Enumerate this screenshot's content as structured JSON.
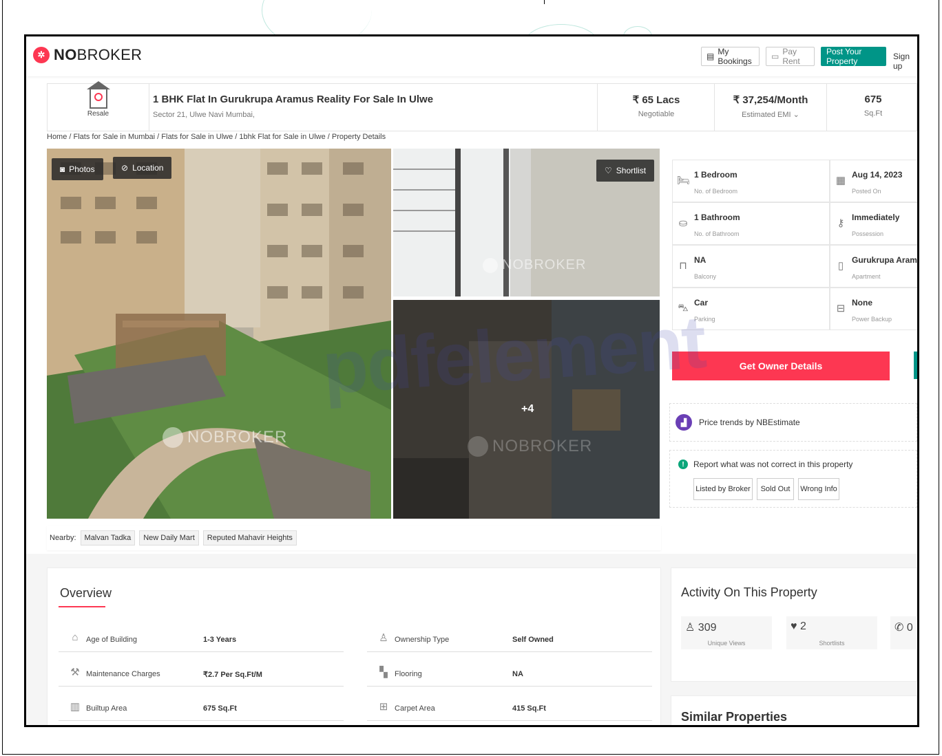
{
  "header": {
    "logo_bold": "NO",
    "logo_rest": "BROKER",
    "my_bookings": "My Bookings",
    "pay_rent": "Pay Rent",
    "post_property": "Post Your Property",
    "sign_up": "Sign up"
  },
  "listing": {
    "badge": "Resale",
    "title": "1 BHK Flat In Gurukrupa Aramus Reality For Sale In Ulwe",
    "address": "Sector 21, Ulwe Navi Mumbai,",
    "price": "₹ 65 Lacs",
    "price_note": "Negotiable",
    "emi": "₹ 37,254/Month",
    "emi_note": "Estimated EMI ⌄",
    "area": "675",
    "area_unit": "Sq.Ft"
  },
  "breadcrumb": "Home / Flats for Sale in Mumbai / Flats for Sale in Ulwe / 1bhk Flat for Sale in Ulwe / Property Details",
  "gallery": {
    "photos_label": "Photos",
    "location_label": "Location",
    "shortlist_label": "Shortlist",
    "watermark": "NOBROKER",
    "more_count": "+4"
  },
  "nearby": {
    "label": "Nearby:",
    "tags": [
      "Malvan Tadka",
      "New Daily Mart",
      "Reputed Mahavir Heights"
    ]
  },
  "specs": [
    {
      "value": "1 Bedroom",
      "label": "No. of Bedroom",
      "icon": "bed-icon"
    },
    {
      "value": "Aug 14, 2023",
      "label": "Posted On",
      "icon": "calendar-icon"
    },
    {
      "value": "1 Bathroom",
      "label": "No. of Bathroom",
      "icon": "bath-icon"
    },
    {
      "value": "Immediately",
      "label": "Possession",
      "icon": "key-icon"
    },
    {
      "value": "NA",
      "label": "Balcony",
      "icon": "balcony-icon"
    },
    {
      "value": "Gurukrupa Aramus ...",
      "label": "Apartment",
      "icon": "building-icon"
    },
    {
      "value": "Car",
      "label": "Parking",
      "icon": "car-icon"
    },
    {
      "value": "None",
      "label": "Power Backup",
      "icon": "battery-icon"
    }
  ],
  "actions": {
    "owner_details": "Get Owner Details",
    "price_trends": "Price trends by NBEstimate",
    "report_question": "Report what was not correct in this property",
    "report_options": [
      "Listed by Broker",
      "Sold Out",
      "Wrong Info"
    ]
  },
  "overview": {
    "title": "Overview",
    "rows": [
      {
        "key": "Age of Building",
        "value": "1-3 Years",
        "icon": "building-age-icon"
      },
      {
        "key": "Ownership Type",
        "value": "Self Owned",
        "icon": "ownership-icon"
      },
      {
        "key": "Maintenance Charges",
        "value": "₹2.7 Per Sq.Ft/M",
        "icon": "maintenance-icon"
      },
      {
        "key": "Flooring",
        "value": "NA",
        "icon": "flooring-icon"
      },
      {
        "key": "Builtup Area",
        "value": "675 Sq.Ft",
        "icon": "builtup-icon"
      },
      {
        "key": "Carpet Area",
        "value": "415 Sq.Ft",
        "icon": "carpet-icon"
      }
    ]
  },
  "activity": {
    "title": "Activity On This Property",
    "stats": [
      {
        "count": "309",
        "label": "Unique Views",
        "icon": "person-icon"
      },
      {
        "count": "2",
        "label": "Shortlists",
        "icon": "heart-icon"
      },
      {
        "count": "0",
        "label": "",
        "icon": "phone-icon"
      }
    ]
  },
  "similar": {
    "title": "Similar Properties"
  },
  "pdf_watermark": "pdfelement",
  "colors": {
    "brand_red": "#fd3752",
    "brand_teal": "#009587"
  }
}
